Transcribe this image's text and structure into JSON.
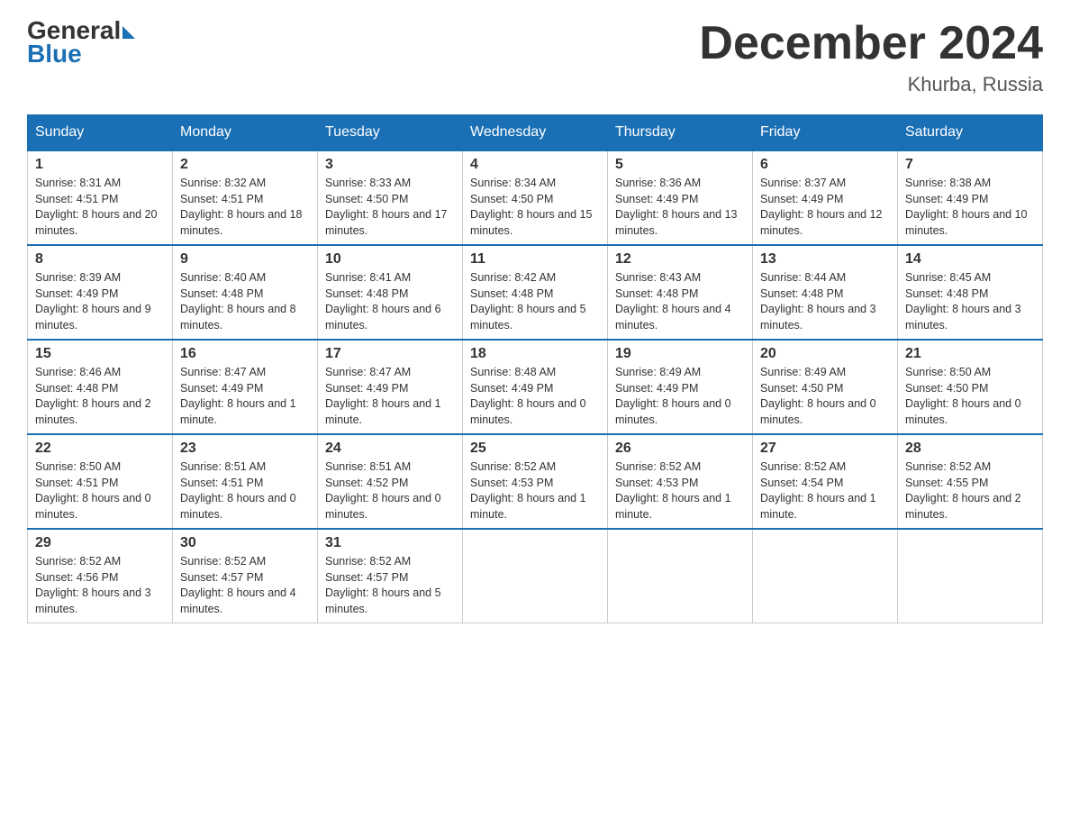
{
  "header": {
    "logo_line1": "General",
    "logo_line2": "Blue",
    "title": "December 2024",
    "subtitle": "Khurba, Russia"
  },
  "days_of_week": [
    "Sunday",
    "Monday",
    "Tuesday",
    "Wednesday",
    "Thursday",
    "Friday",
    "Saturday"
  ],
  "weeks": [
    [
      {
        "day": "1",
        "sunrise": "8:31 AM",
        "sunset": "4:51 PM",
        "daylight": "8 hours and 20 minutes."
      },
      {
        "day": "2",
        "sunrise": "8:32 AM",
        "sunset": "4:51 PM",
        "daylight": "8 hours and 18 minutes."
      },
      {
        "day": "3",
        "sunrise": "8:33 AM",
        "sunset": "4:50 PM",
        "daylight": "8 hours and 17 minutes."
      },
      {
        "day": "4",
        "sunrise": "8:34 AM",
        "sunset": "4:50 PM",
        "daylight": "8 hours and 15 minutes."
      },
      {
        "day": "5",
        "sunrise": "8:36 AM",
        "sunset": "4:49 PM",
        "daylight": "8 hours and 13 minutes."
      },
      {
        "day": "6",
        "sunrise": "8:37 AM",
        "sunset": "4:49 PM",
        "daylight": "8 hours and 12 minutes."
      },
      {
        "day": "7",
        "sunrise": "8:38 AM",
        "sunset": "4:49 PM",
        "daylight": "8 hours and 10 minutes."
      }
    ],
    [
      {
        "day": "8",
        "sunrise": "8:39 AM",
        "sunset": "4:49 PM",
        "daylight": "8 hours and 9 minutes."
      },
      {
        "day": "9",
        "sunrise": "8:40 AM",
        "sunset": "4:48 PM",
        "daylight": "8 hours and 8 minutes."
      },
      {
        "day": "10",
        "sunrise": "8:41 AM",
        "sunset": "4:48 PM",
        "daylight": "8 hours and 6 minutes."
      },
      {
        "day": "11",
        "sunrise": "8:42 AM",
        "sunset": "4:48 PM",
        "daylight": "8 hours and 5 minutes."
      },
      {
        "day": "12",
        "sunrise": "8:43 AM",
        "sunset": "4:48 PM",
        "daylight": "8 hours and 4 minutes."
      },
      {
        "day": "13",
        "sunrise": "8:44 AM",
        "sunset": "4:48 PM",
        "daylight": "8 hours and 3 minutes."
      },
      {
        "day": "14",
        "sunrise": "8:45 AM",
        "sunset": "4:48 PM",
        "daylight": "8 hours and 3 minutes."
      }
    ],
    [
      {
        "day": "15",
        "sunrise": "8:46 AM",
        "sunset": "4:48 PM",
        "daylight": "8 hours and 2 minutes."
      },
      {
        "day": "16",
        "sunrise": "8:47 AM",
        "sunset": "4:49 PM",
        "daylight": "8 hours and 1 minute."
      },
      {
        "day": "17",
        "sunrise": "8:47 AM",
        "sunset": "4:49 PM",
        "daylight": "8 hours and 1 minute."
      },
      {
        "day": "18",
        "sunrise": "8:48 AM",
        "sunset": "4:49 PM",
        "daylight": "8 hours and 0 minutes."
      },
      {
        "day": "19",
        "sunrise": "8:49 AM",
        "sunset": "4:49 PM",
        "daylight": "8 hours and 0 minutes."
      },
      {
        "day": "20",
        "sunrise": "8:49 AM",
        "sunset": "4:50 PM",
        "daylight": "8 hours and 0 minutes."
      },
      {
        "day": "21",
        "sunrise": "8:50 AM",
        "sunset": "4:50 PM",
        "daylight": "8 hours and 0 minutes."
      }
    ],
    [
      {
        "day": "22",
        "sunrise": "8:50 AM",
        "sunset": "4:51 PM",
        "daylight": "8 hours and 0 minutes."
      },
      {
        "day": "23",
        "sunrise": "8:51 AM",
        "sunset": "4:51 PM",
        "daylight": "8 hours and 0 minutes."
      },
      {
        "day": "24",
        "sunrise": "8:51 AM",
        "sunset": "4:52 PM",
        "daylight": "8 hours and 0 minutes."
      },
      {
        "day": "25",
        "sunrise": "8:52 AM",
        "sunset": "4:53 PM",
        "daylight": "8 hours and 1 minute."
      },
      {
        "day": "26",
        "sunrise": "8:52 AM",
        "sunset": "4:53 PM",
        "daylight": "8 hours and 1 minute."
      },
      {
        "day": "27",
        "sunrise": "8:52 AM",
        "sunset": "4:54 PM",
        "daylight": "8 hours and 1 minute."
      },
      {
        "day": "28",
        "sunrise": "8:52 AM",
        "sunset": "4:55 PM",
        "daylight": "8 hours and 2 minutes."
      }
    ],
    [
      {
        "day": "29",
        "sunrise": "8:52 AM",
        "sunset": "4:56 PM",
        "daylight": "8 hours and 3 minutes."
      },
      {
        "day": "30",
        "sunrise": "8:52 AM",
        "sunset": "4:57 PM",
        "daylight": "8 hours and 4 minutes."
      },
      {
        "day": "31",
        "sunrise": "8:52 AM",
        "sunset": "4:57 PM",
        "daylight": "8 hours and 5 minutes."
      },
      null,
      null,
      null,
      null
    ]
  ]
}
